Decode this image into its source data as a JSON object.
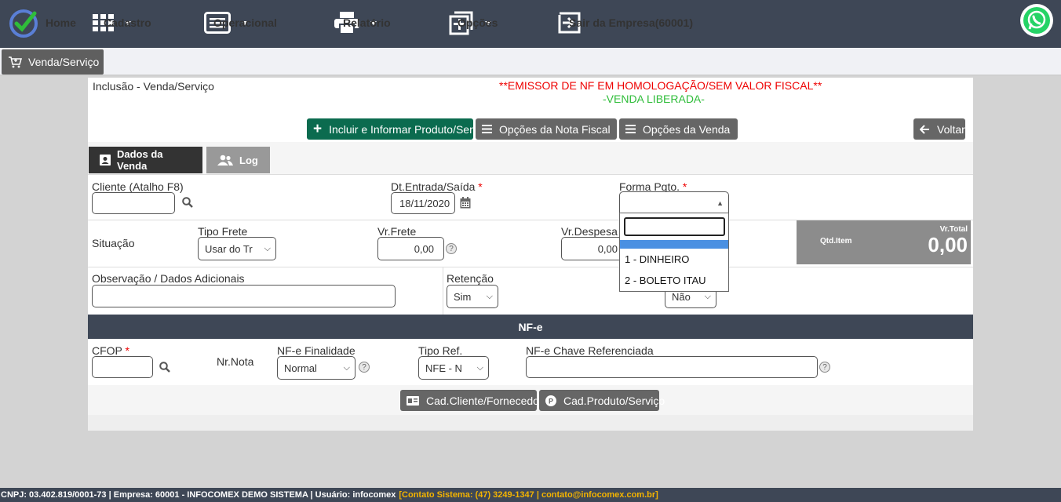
{
  "nav": {
    "home": "Home",
    "cadastro": "Cadastro",
    "operacional": "Operacional",
    "relatorio": "Relatório",
    "opcoes": "Opções",
    "sair": "Sair da Empresa(60001)"
  },
  "tab_button": "Venda/Serviço",
  "header": {
    "title": "Inclusão - Venda/Serviço",
    "warning": "**EMISSOR DE NF EM HOMOLOGAÇÃO/SEM VALOR FISCAL**",
    "status": "-VENDA LIBERADA-"
  },
  "toolbar": {
    "incluir": "Incluir e Informar Produto/Serv.",
    "opcoes_nf": "Opções da Nota Fiscal",
    "opcoes_venda": "Opções da Venda",
    "voltar": "Voltar"
  },
  "tabs": {
    "dados": "Dados da Venda",
    "log": "Log"
  },
  "form": {
    "cliente_label": "Cliente (Atalho F8)",
    "dt_label": "Dt.Entrada/Saída",
    "dt_value": "18/11/2020",
    "forma_label": "Forma Pgto.",
    "required_mark": "*",
    "situacao_label": "Situação",
    "tipo_frete_label": "Tipo Frete",
    "tipo_frete_value": "Usar do Tr",
    "vr_frete_label": "Vr.Frete",
    "vr_frete_value": "0,00",
    "vr_despesa_label": "Vr.Despesa",
    "vr_despesa_value": "0,00",
    "qtd_item_label": "Qtd.Item",
    "vr_total_label": "Vr.Total",
    "vr_total_value": "0,00",
    "obs_label": "Observação / Dados Adicionais",
    "retencao_label": "Retenção",
    "retencao_value": "Sim",
    "nao_value": "Não"
  },
  "dropdown": {
    "options": [
      "1 - DINHEIRO",
      "2 - BOLETO ITAU"
    ]
  },
  "nfe": {
    "title": "NF-e",
    "cfop_label": "CFOP",
    "nr_nota_label": "Nr.Nota",
    "finalidade_label": "NF-e Finalidade",
    "finalidade_value": "Normal",
    "tipo_ref_label": "Tipo Ref.",
    "tipo_ref_value": "NFE - N",
    "chave_label": "NF-e Chave Referenciada"
  },
  "bottom_buttons": {
    "cad_cliente": "Cad.Cliente/Fornecedor",
    "cad_produto": "Cad.Produto/Serviço"
  },
  "footer": {
    "info": "CNPJ: 03.402.819/0001-73 | Empresa: 60001 - INFOCOMEX DEMO SISTEMA | Usuário: infocomex",
    "contact": "[Contato Sistema: (47) 3249-1347 | contato@infocomex.com.br]"
  },
  "colors": {
    "nav_bg": "#3e4756",
    "accent_green": "#0b6b4f",
    "warning_red": "#e00000",
    "status_green": "#2fbd3a",
    "dropdown_highlight": "#4a90e2"
  }
}
